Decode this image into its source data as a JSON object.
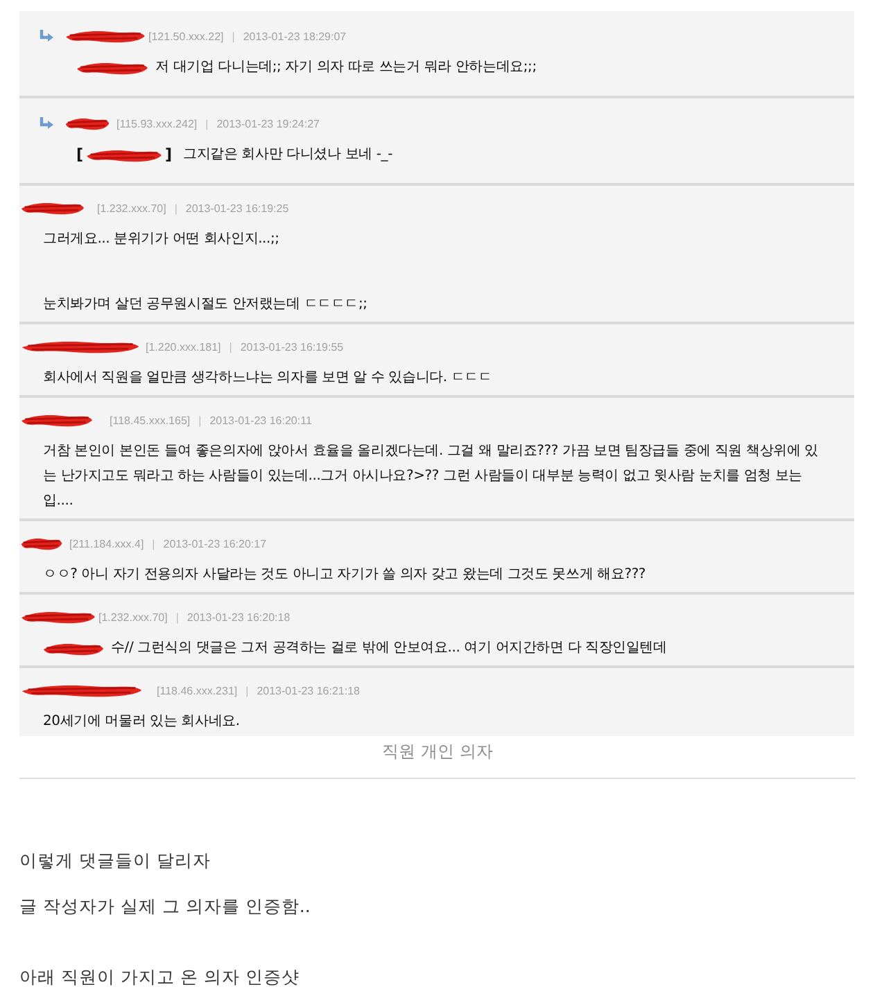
{
  "comments": [
    {
      "reply": true,
      "author": {
        "kind": "redacted"
      },
      "ip": "[121.50.xxx.22]",
      "separator": "|",
      "date": "2013-01-23 18:29:07",
      "mention": {
        "kind": "redacted"
      },
      "paragraphs": [
        [
          "저 대기업 다니는데;; 자기 의자 따로 쓰는거 뭐라 안하는데요;;;"
        ]
      ]
    },
    {
      "reply": true,
      "author": {
        "kind": "redacted"
      },
      "ip": "[115.93.xxx.242]",
      "separator": "|",
      "date": "2013-01-23 19:24:27",
      "mention": {
        "kind": "bracketed",
        "open": "[",
        "close": "]"
      },
      "paragraphs": [
        [
          "그지같은 회사만 다니셨나 보네 -_-"
        ]
      ]
    },
    {
      "reply": false,
      "author": {
        "kind": "redacted"
      },
      "ip": "[1.232.xxx.70]",
      "separator": "|",
      "date": "2013-01-23 16:19:25",
      "paragraphs": [
        [
          "그러게요... 분위기가 어떤 회사인지...;;"
        ],
        [
          "눈치봐가며 살던 공무원시절도 안저랬는데 ㄷㄷㄷㄷ;;"
        ]
      ]
    },
    {
      "reply": false,
      "author": {
        "kind": "redacted"
      },
      "ip": "[1.220.xxx.181]",
      "separator": "|",
      "date": "2013-01-23 16:19:55",
      "paragraphs": [
        [
          "회사에서 직원을 얼만큼 생각하느냐는 의자를 보면 알 수 있습니다. ㄷㄷㄷ"
        ]
      ]
    },
    {
      "reply": false,
      "author": {
        "kind": "redacted"
      },
      "ip": "[118.45.xxx.165]",
      "separator": "|",
      "date": "2013-01-23 16:20:11",
      "paragraphs": [
        [
          "거참 본인이 본인돈 들여 좋은의자에 앉아서 효율을 올리겠다는데. 그걸 왜 말리죠??? 가끔 보면 팀장급들 중에 직원 책상위에 있",
          "는 난가지고도 뭐라고 하는 사람들이 있는데...그거 아시나요?>?? 그런 사람들이 대부분 능력이 없고 윗사람 눈치를 엄청 보는",
          "입...."
        ]
      ]
    },
    {
      "reply": false,
      "author": {
        "kind": "redacted"
      },
      "ip": "[211.184.xxx.4]",
      "separator": "|",
      "date": "2013-01-23 16:20:17",
      "paragraphs": [
        [
          "ㅇㅇ? 아니 자기 전용의자 사달라는 것도 아니고 자기가 쓸 의자 갖고 왔는데 그것도 못쓰게 해요???"
        ]
      ]
    },
    {
      "reply": false,
      "author": {
        "kind": "redacted"
      },
      "ip": "[1.232.xxx.70]",
      "separator": "|",
      "date": "2013-01-23 16:20:18",
      "mention": {
        "kind": "redacted"
      },
      "paragraphs": [
        [
          "수// 그런식의 댓글은 그저 공격하는 걸로 밖에 안보여요... 여기 어지간하면 다 직장인일텐데"
        ]
      ]
    },
    {
      "reply": false,
      "author": {
        "kind": "redacted"
      },
      "ip": "[118.46.xxx.231]",
      "separator": "|",
      "date": "2013-01-23 16:21:18",
      "paragraphs": [
        [
          "20세기에 머물러 있는 회사네요."
        ]
      ]
    }
  ],
  "caption": "직원 개인 의자",
  "article": [
    [
      "이렇게 댓글들이 달리자",
      "글 작성자가 실제 그 의자를 인증함.."
    ],
    [
      "아래 직원이 가지고 온 의자 인증샷"
    ]
  ]
}
